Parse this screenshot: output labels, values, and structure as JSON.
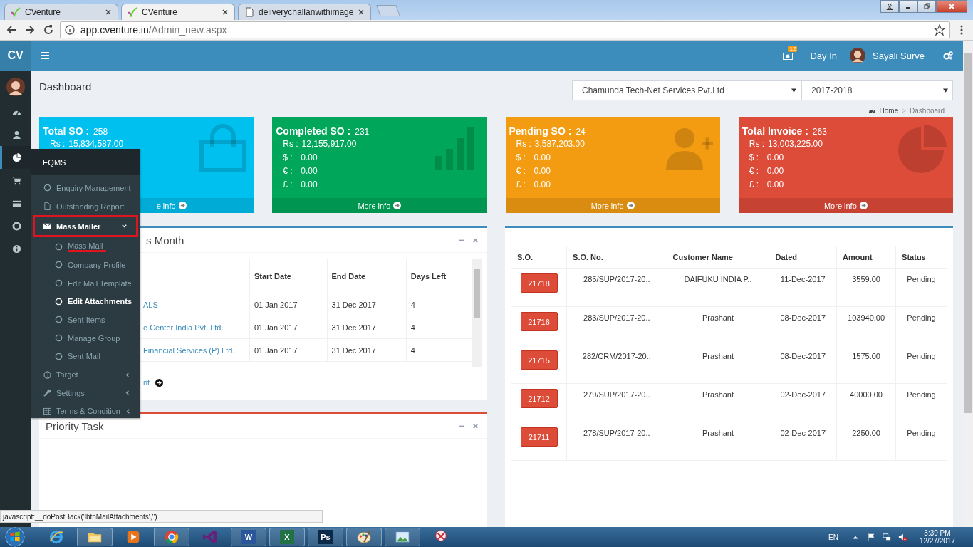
{
  "browser": {
    "tabs": [
      {
        "title": "CVenture",
        "selected": false,
        "kind": "check"
      },
      {
        "title": "CVenture",
        "selected": true,
        "kind": "check"
      },
      {
        "title": "deliverychallanwithimage",
        "selected": false,
        "kind": "page"
      }
    ],
    "url_host": "app.cventure.in",
    "url_path": "/Admin_new.aspx"
  },
  "header": {
    "logo": "CV",
    "notification_count": "12",
    "day_in": "Day In",
    "user": "Sayali Surve"
  },
  "sidebar": {
    "items": [
      {
        "kind": "dashboard",
        "selected": false
      },
      {
        "kind": "user",
        "selected": false
      },
      {
        "kind": "pie",
        "selected": true
      },
      {
        "kind": "cart",
        "selected": false
      },
      {
        "kind": "card",
        "selected": false
      },
      {
        "kind": "lifebuoy",
        "selected": false
      },
      {
        "kind": "info",
        "selected": false
      }
    ]
  },
  "flyout": {
    "title": "EQMS",
    "items": [
      {
        "label": "Enquiry Management",
        "kind": "circle",
        "annotated": false
      },
      {
        "label": "Outstanding Report",
        "kind": "file",
        "annotated": false
      },
      {
        "label": "Mass Mailer",
        "kind": "envelope",
        "expanded": true,
        "annotated": true,
        "children": [
          {
            "label": "Mass Mail",
            "selected": false,
            "annotated": true
          },
          {
            "label": "Company Profile",
            "selected": false,
            "annotated": false
          },
          {
            "label": "Edit Mail Template",
            "selected": false,
            "annotated": false
          },
          {
            "label": "Edit Attachments",
            "selected": true,
            "annotated": false
          },
          {
            "label": "Sent Items",
            "selected": false,
            "annotated": false
          },
          {
            "label": "Manage Group",
            "selected": false,
            "annotated": false
          },
          {
            "label": "Sent Mail",
            "selected": false,
            "annotated": false
          }
        ]
      },
      {
        "label": "Target",
        "kind": "arrow",
        "expanded": false,
        "annotated": false
      },
      {
        "label": "Settings",
        "kind": "wrench",
        "expanded": false,
        "annotated": false
      },
      {
        "label": "Terms & Condition",
        "kind": "table",
        "expanded": false,
        "annotated": false
      }
    ]
  },
  "page": {
    "title": "Dashboard",
    "company": "Chamunda Tech-Net Services Pvt.Ltd",
    "year": "2017-2018",
    "breadcrumb": [
      "Home",
      "Dashboard"
    ],
    "breadcrumb_separator": ">"
  },
  "cards": [
    {
      "title": "Total SO :",
      "count": "258",
      "color": "#00c0ef",
      "kind": "bag",
      "lines": [
        {
          "label": "Rs :",
          "value": "15,834,587.00"
        }
      ],
      "more": "e info"
    },
    {
      "title": "Completed SO :",
      "count": "231",
      "color": "#00a65a",
      "kind": "bars",
      "lines": [
        {
          "label": "Rs :",
          "value": "12,155,917.00"
        },
        {
          "label": "$ :",
          "value": "0.00"
        },
        {
          "label": "€ :",
          "value": "0.00"
        },
        {
          "label": "£ :",
          "value": "0.00"
        }
      ],
      "more": "More info"
    },
    {
      "title": "Pending SO :",
      "count": "24",
      "color": "#f39c12",
      "kind": "user-plus",
      "lines": [
        {
          "label": "Rs :",
          "value": "3,587,203.00"
        },
        {
          "label": "$ :",
          "value": "0.00"
        },
        {
          "label": "€ :",
          "value": "0.00"
        },
        {
          "label": "£ :",
          "value": "0.00"
        }
      ],
      "more": "More info"
    },
    {
      "title": "Total Invoice :",
      "count": "263",
      "color": "#dd4b39",
      "kind": "pie",
      "lines": [
        {
          "label": "Rs :",
          "value": "13,003,225.00"
        },
        {
          "label": "$ :",
          "value": "0.00"
        },
        {
          "label": "€ :",
          "value": "0.00"
        },
        {
          "label": "£ :",
          "value": "0.00"
        }
      ],
      "more": "More info"
    }
  ],
  "expiry_panel": {
    "title": "s Month",
    "columns": [
      "Start Date",
      "End Date",
      "Days Left"
    ],
    "rows": [
      {
        "name": "ALS",
        "start": "01 Jan 2017",
        "end": "31 Dec 2017",
        "days": "4"
      },
      {
        "name": "e Center India Pvt. Ltd.",
        "start": "01 Jan 2017",
        "end": "31 Dec 2017",
        "days": "4"
      },
      {
        "name": "Financial Services (P) Ltd.",
        "start": "01 Jan 2017",
        "end": "31 Dec 2017",
        "days": "4"
      }
    ],
    "footer_link": "nt"
  },
  "priority_panel": {
    "title": "Priority Task"
  },
  "so_table": {
    "columns": [
      "S.O.",
      "S.O. No.",
      "Customer Name",
      "Dated",
      "Amount",
      "Status"
    ],
    "rows": [
      {
        "so": "21718",
        "so_no": "285/SUP/2017-20..",
        "customer": "DAIFUKU INDIA P..",
        "dated": "11-Dec-2017",
        "amount": "3559.00",
        "status": "Pending"
      },
      {
        "so": "21716",
        "so_no": "283/SUP/2017-20..",
        "customer": "Prashant",
        "dated": "08-Dec-2017",
        "amount": "103940.00",
        "status": "Pending"
      },
      {
        "so": "21715",
        "so_no": "282/CRM/2017-20..",
        "customer": "Prashant",
        "dated": "08-Dec-2017",
        "amount": "1575.00",
        "status": "Pending"
      },
      {
        "so": "21712",
        "so_no": "279/SUP/2017-20..",
        "customer": "Prashant",
        "dated": "02-Dec-2017",
        "amount": "40000.00",
        "status": "Pending"
      },
      {
        "so": "21711",
        "so_no": "278/SUP/2017-20..",
        "customer": "Prashant",
        "dated": "02-Dec-2017",
        "amount": "2250.00",
        "status": "Pending"
      }
    ]
  },
  "status_url": "javascript:__doPostBack('lbtnMailAttachments','')",
  "taskbar": {
    "apps": [
      {
        "kind": "ie",
        "open": false
      },
      {
        "kind": "folder",
        "open": true
      },
      {
        "kind": "media",
        "open": false
      },
      {
        "kind": "chrome",
        "open": true
      },
      {
        "kind": "vs",
        "open": false
      },
      {
        "kind": "letter",
        "open": true,
        "label": "W",
        "color": "#2b579a"
      },
      {
        "kind": "letter",
        "open": true,
        "label": "X",
        "color": "#217346"
      },
      {
        "kind": "letter",
        "open": true,
        "label": "Ps",
        "color": "#0b2a4a"
      },
      {
        "kind": "paint",
        "open": true
      },
      {
        "kind": "photo",
        "open": true
      },
      {
        "kind": "snip",
        "open": false
      }
    ],
    "language": "EN",
    "time": "3:39 PM",
    "date": "12/27/2017"
  }
}
